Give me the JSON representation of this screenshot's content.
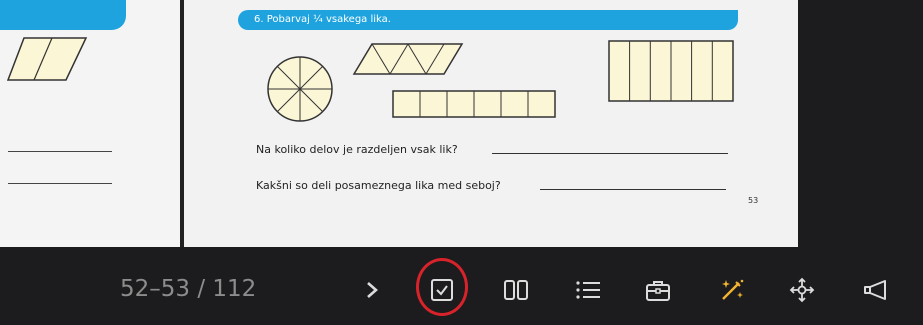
{
  "book": {
    "task_title": "6. Pobarvaj ¼ vsakega lika.",
    "question_1": "Na koliko delov je razdeljen vsak lik?",
    "question_2": "Kakšni so deli posameznega lika med seboj?",
    "page_number": "53"
  },
  "toolbar": {
    "page_indicator": "52–53 / 112",
    "buttons": [
      {
        "name": "next-page-button",
        "icon": "chevron-right-icon"
      },
      {
        "name": "checkbox-button",
        "icon": "checkbox-icon"
      },
      {
        "name": "two-page-view-button",
        "icon": "two-pages-icon"
      },
      {
        "name": "list-button",
        "icon": "list-icon"
      },
      {
        "name": "toolbox-button",
        "icon": "briefcase-icon"
      },
      {
        "name": "magic-wand-button",
        "icon": "magic-wand-icon"
      },
      {
        "name": "move-button",
        "icon": "move-arrows-icon"
      },
      {
        "name": "announce-button",
        "icon": "megaphone-icon"
      }
    ],
    "accent": "#f2b431",
    "icon_color": "#d9d9d9",
    "highlight_color": "#d8232a"
  }
}
